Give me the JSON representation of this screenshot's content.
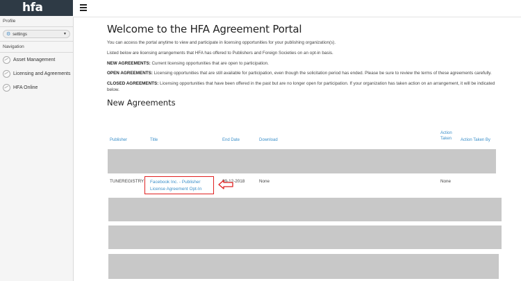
{
  "sidebar": {
    "logo": "hfa",
    "profile_label": "Profile",
    "profile_select": "settings",
    "navigation_label": "Navigation",
    "items": [
      {
        "label": "Asset Management",
        "icon": "globe-icon"
      },
      {
        "label": "Licensing and Agreements",
        "icon": "globe-icon"
      },
      {
        "label": "HFA Online",
        "icon": "globe-icon"
      }
    ]
  },
  "header": {
    "menu_icon": "hamburger-menu-icon"
  },
  "main": {
    "title": "Welcome to the HFA Agreement Portal",
    "intro1": "You can access the portal anytime to view and participate in licensing opportunities for your publishing organization(s).",
    "intro2": "Listed below are licensing arrangements that HFA has offered to Publishers and Foreign Societies on an opt-in basis.",
    "new_label": "NEW AGREEMENTS:",
    "new_text": " Current licensing opportunities that are open to participation.",
    "open_label": "OPEN AGREEMENTS:",
    "open_text": " Licensing opportunities that are still available for participation, even though the solicitation period has ended. Please be sure to review the terms of these agreements carefully.",
    "closed_label": "CLOSED AGREEMENTS:",
    "closed_text": " Licensing opportunities that have been offered in the past but are no longer open for participation. If your organization has taken action on an arrangement, it will be indicated below.",
    "section_title": "New Agreements"
  },
  "table": {
    "headers": {
      "publisher": "Publisher",
      "title": "Title",
      "end_date": "End Date",
      "download": "Download",
      "action_taken_line1": "Action",
      "action_taken_line2": "Taken",
      "action_taken_by": "Action Taken By"
    },
    "row": {
      "publisher": "TUNEREGISTRY",
      "title": "Facebook Inc. - Publisher License Agreement Opt-In",
      "end_date": "09-12-2018",
      "download": "None",
      "action_taken": "None"
    }
  },
  "colors": {
    "sidebar_header": "#2e3a45",
    "link": "#3b8fc9",
    "highlight": "#e02020",
    "redacted": "#c8c8c8"
  }
}
